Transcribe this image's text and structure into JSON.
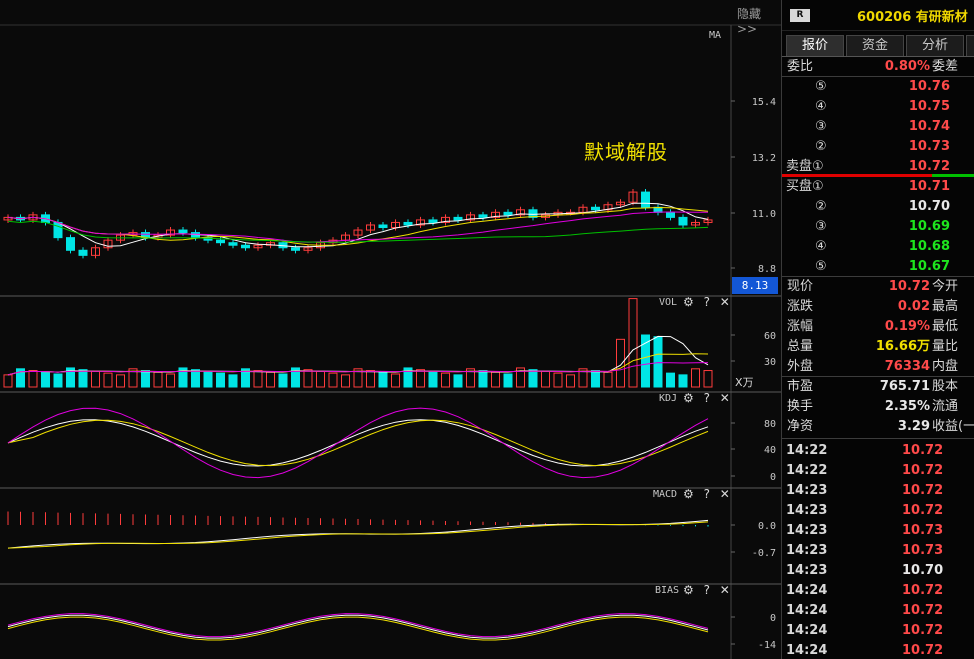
{
  "toolbar": {
    "hide_label": "隐藏>>"
  },
  "main_panel": {
    "ma_label": "MA",
    "annotation": "默域解股",
    "current_price_badge": "8.13",
    "y_ticks": [
      "15.4",
      "13.2",
      "11.0",
      "8.8"
    ]
  },
  "panels": {
    "vol": {
      "label": "VOL",
      "y_ticks": [
        "60",
        "30"
      ],
      "unit": "X万"
    },
    "kdj": {
      "label": "KDJ",
      "y_ticks": [
        "80",
        "40",
        "0"
      ]
    },
    "macd": {
      "label": "MACD",
      "y_ticks": [
        "0.0",
        "-0.7"
      ]
    },
    "bias": {
      "label": "BIAS",
      "y_ticks": [
        "0",
        "-14"
      ]
    },
    "tools": "⚙ ? ✕"
  },
  "colors": {
    "up": "#ff3c3c",
    "down": "#00e5e5",
    "ma5": "#ffffff",
    "ma10": "#f0e000",
    "ma20": "#e000e0",
    "ma60": "#00c000",
    "badge": "#1357d6"
  },
  "side": {
    "badge": "R",
    "title": "600206 有研新材",
    "tabs": [
      "报价",
      "资金",
      "分析"
    ],
    "weibi": {
      "label": "委比",
      "value": "0.80%",
      "label2": "委差"
    },
    "sell": [
      {
        "level": "⑤",
        "price": "10.76"
      },
      {
        "level": "④",
        "price": "10.75"
      },
      {
        "level": "③",
        "price": "10.74"
      },
      {
        "level": "②",
        "price": "10.73"
      },
      {
        "level": "卖盘①",
        "price": "10.72"
      }
    ],
    "buy": [
      {
        "level": "买盘①",
        "price": "10.71"
      },
      {
        "level": "②",
        "price": "10.70"
      },
      {
        "level": "③",
        "price": "10.69"
      },
      {
        "level": "④",
        "price": "10.68"
      },
      {
        "level": "⑤",
        "price": "10.67"
      }
    ],
    "stats": [
      {
        "label": "现价",
        "value": "10.72",
        "label2": "今开",
        "color": "red"
      },
      {
        "label": "涨跌",
        "value": "0.02",
        "label2": "最高",
        "color": "red"
      },
      {
        "label": "涨幅",
        "value": "0.19%",
        "label2": "最低",
        "color": "red"
      },
      {
        "label": "总量",
        "value": "16.66万",
        "label2": "量比",
        "color": "yellow"
      },
      {
        "label": "外盘",
        "value": "76334",
        "label2": "内盘",
        "color": "red"
      }
    ],
    "stats2": [
      {
        "label": "市盈",
        "value": "765.71",
        "label2": "股本",
        "color": "white"
      },
      {
        "label": "换手",
        "value": "2.35%",
        "label2": "流通",
        "color": "white"
      },
      {
        "label": "净资",
        "value": "3.29",
        "label2": "收益(一",
        "color": "white"
      }
    ],
    "ticks": [
      {
        "time": "14:22",
        "price": "10.72",
        "color": "red"
      },
      {
        "time": "14:22",
        "price": "10.72",
        "color": "red"
      },
      {
        "time": "14:23",
        "price": "10.72",
        "color": "red"
      },
      {
        "time": "14:23",
        "price": "10.72",
        "color": "red"
      },
      {
        "time": "14:23",
        "price": "10.73",
        "color": "red"
      },
      {
        "time": "14:23",
        "price": "10.73",
        "color": "red"
      },
      {
        "time": "14:23",
        "price": "10.70",
        "color": "white"
      },
      {
        "time": "14:24",
        "price": "10.72",
        "color": "red"
      },
      {
        "time": "14:24",
        "price": "10.72",
        "color": "red"
      },
      {
        "time": "14:24",
        "price": "10.72",
        "color": "red"
      },
      {
        "time": "14:24",
        "price": "10.72",
        "color": "red"
      }
    ]
  }
}
